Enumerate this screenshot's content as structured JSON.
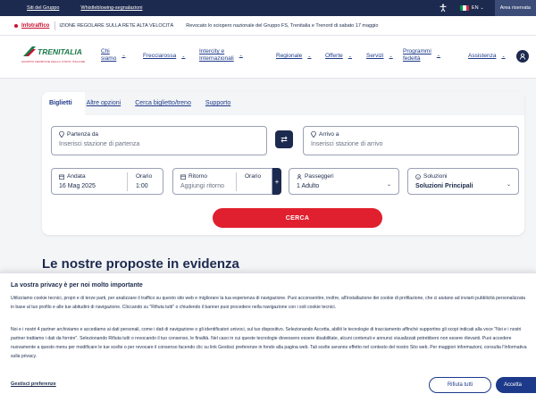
{
  "topbar": {
    "link_group": "Siti del Gruppo",
    "link_whistle": "Whistleblowing-segnalazioni",
    "lang": "EN",
    "reserved": "Area riservata",
    "flag_colors": [
      "#009246",
      "#ffffff",
      "#ce2b37"
    ]
  },
  "infobar": {
    "label": "Infotraffico",
    "msg1": "IZIONE REGOLARE SULLA RETE ALTA VELOCITÀ",
    "msg2": "Revocato lo sciopero nazionale del Gruppo FS, Trenitalia e Trenord di sabato 17 maggio"
  },
  "logo": {
    "word": "TRENITALIA",
    "tag": "GRUPPO FERROVIE DELLO STATO ITALIANE"
  },
  "nav": {
    "items": [
      {
        "l1": "Chi",
        "l2": "siamo"
      },
      {
        "l1": "Frecciarossa",
        "l2": ""
      },
      {
        "l1": "Intercity e",
        "l2": "Internazionali"
      },
      {
        "l1": "Regionale",
        "l2": ""
      },
      {
        "l1": "Offerte",
        "l2": ""
      },
      {
        "l1": "Servizi",
        "l2": ""
      },
      {
        "l1": "Programmi",
        "l2": "fedeltà"
      },
      {
        "l1": "Assistenza",
        "l2": ""
      }
    ]
  },
  "search": {
    "tabs": [
      "Biglietti",
      "Altre opzioni",
      "Cerca biglietto/treno",
      "Supporto"
    ],
    "from_label": "Partenza da",
    "from_placeholder": "Inserisci stazione di partenza",
    "to_label": "Arrivo a",
    "to_placeholder": "Inserisci stazione di arrivo",
    "depart_label": "Andata",
    "depart_date": "16 Mag 2025",
    "depart_time_label": "Orario",
    "depart_time": "1:00",
    "return_label": "Ritorno",
    "return_value": "Aggiungi ritorno",
    "return_time_label": "Orario",
    "passengers_label": "Passeggeri",
    "passengers_value": "1 Adulto",
    "solutions_label": "Soluzioni",
    "solutions_value": "Soluzioni Principali",
    "submit": "CERCA",
    "accent": "#e0202e"
  },
  "section": {
    "title": "Le nostre proposte in evidenza"
  },
  "cookie": {
    "title": "La vostra privacy è per noi molto importante",
    "p1": "Utilizziamo cookie tecnici, propri e di terze parti, per analizzare il traffico su questo sito web e migliorare la tua esperienza di navigazione. Puoi acconsentire, inoltre, all'installazione dei cookie di profilazione, che ci aiutano ad inviarti pubblicità personalizzata in base al tuo profilo e alle tue abitudini di navigazione. Cliccando su \"Rifiuta tutti\" o chiudendo il banner puoi procedere nella navigazione con i soli cookie tecnici.",
    "p2": "Noi e i nostri 4 partner archiviamo e accediamo ai dati personali, come i dati di navigazione o gli identificatori univoci, sul tuo dispositivo. Selezionando Accetta, abiliti le tecnologie di tracciamento affinché supportino gli scopi indicati alla voce \"Noi e i nostri partner trattiamo i dati da fornire\". Selezionando Rifiuta tutti o revocando il tuo consenso, le finalità. Nel caso in cui queste tecnologie dovessero essere disabilitate, alcuni contenuti e annunci visualizzati potrebbero non essere rilevanti. Puoi accedere nuovamente a questo menu per modificare le tue scelte o per revocare il consenso facendo clic su link Gestisci preferenze in fondo alla pagina web. Tali scelte avranno effetto nel contesto del nostro Sito web. Per maggiori informazioni, consulta l'Informativa sulla privacy.",
    "manage": "Gestisci preferenze",
    "reject": "Rifiuta tutti",
    "accept": "Accetta"
  }
}
